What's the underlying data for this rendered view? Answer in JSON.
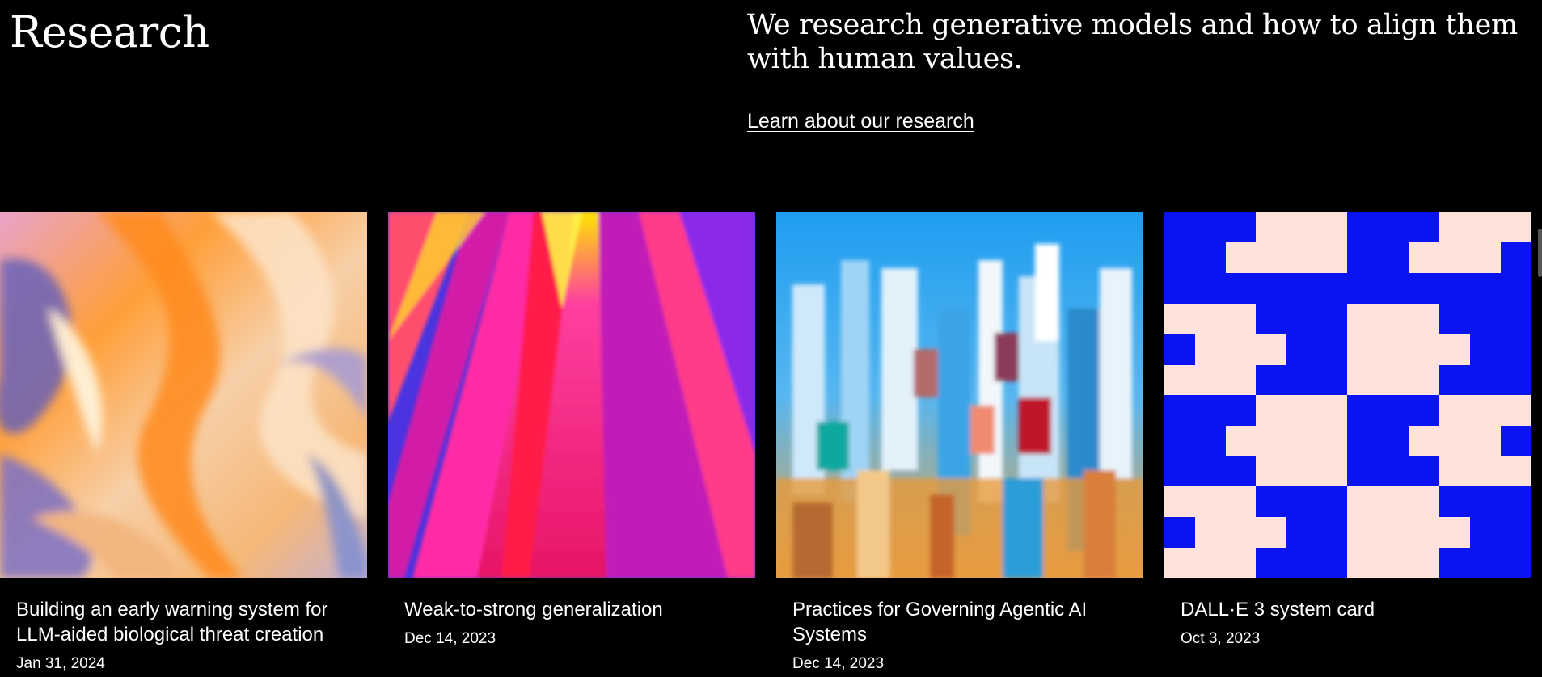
{
  "header": {
    "title": "Research",
    "tagline": "We research generative models and how to align them with human values.",
    "link_label": "Learn about our research"
  },
  "cards": [
    {
      "title": "Building an early warning system for LLM-aided biological threat creation",
      "date": "Jan 31, 2024"
    },
    {
      "title": "Weak-to-strong generalization",
      "date": "Dec 14, 2023"
    },
    {
      "title": "Practices for Governing Agentic AI Systems",
      "date": "Dec 14, 2023"
    },
    {
      "title": "DALL·E 3 system card",
      "date": "Oct 3, 2023"
    }
  ],
  "colors": {
    "background": "#000000",
    "text": "#ffffff",
    "pattern_blue": "#0a14f0",
    "pattern_pink": "#fde2dc"
  }
}
